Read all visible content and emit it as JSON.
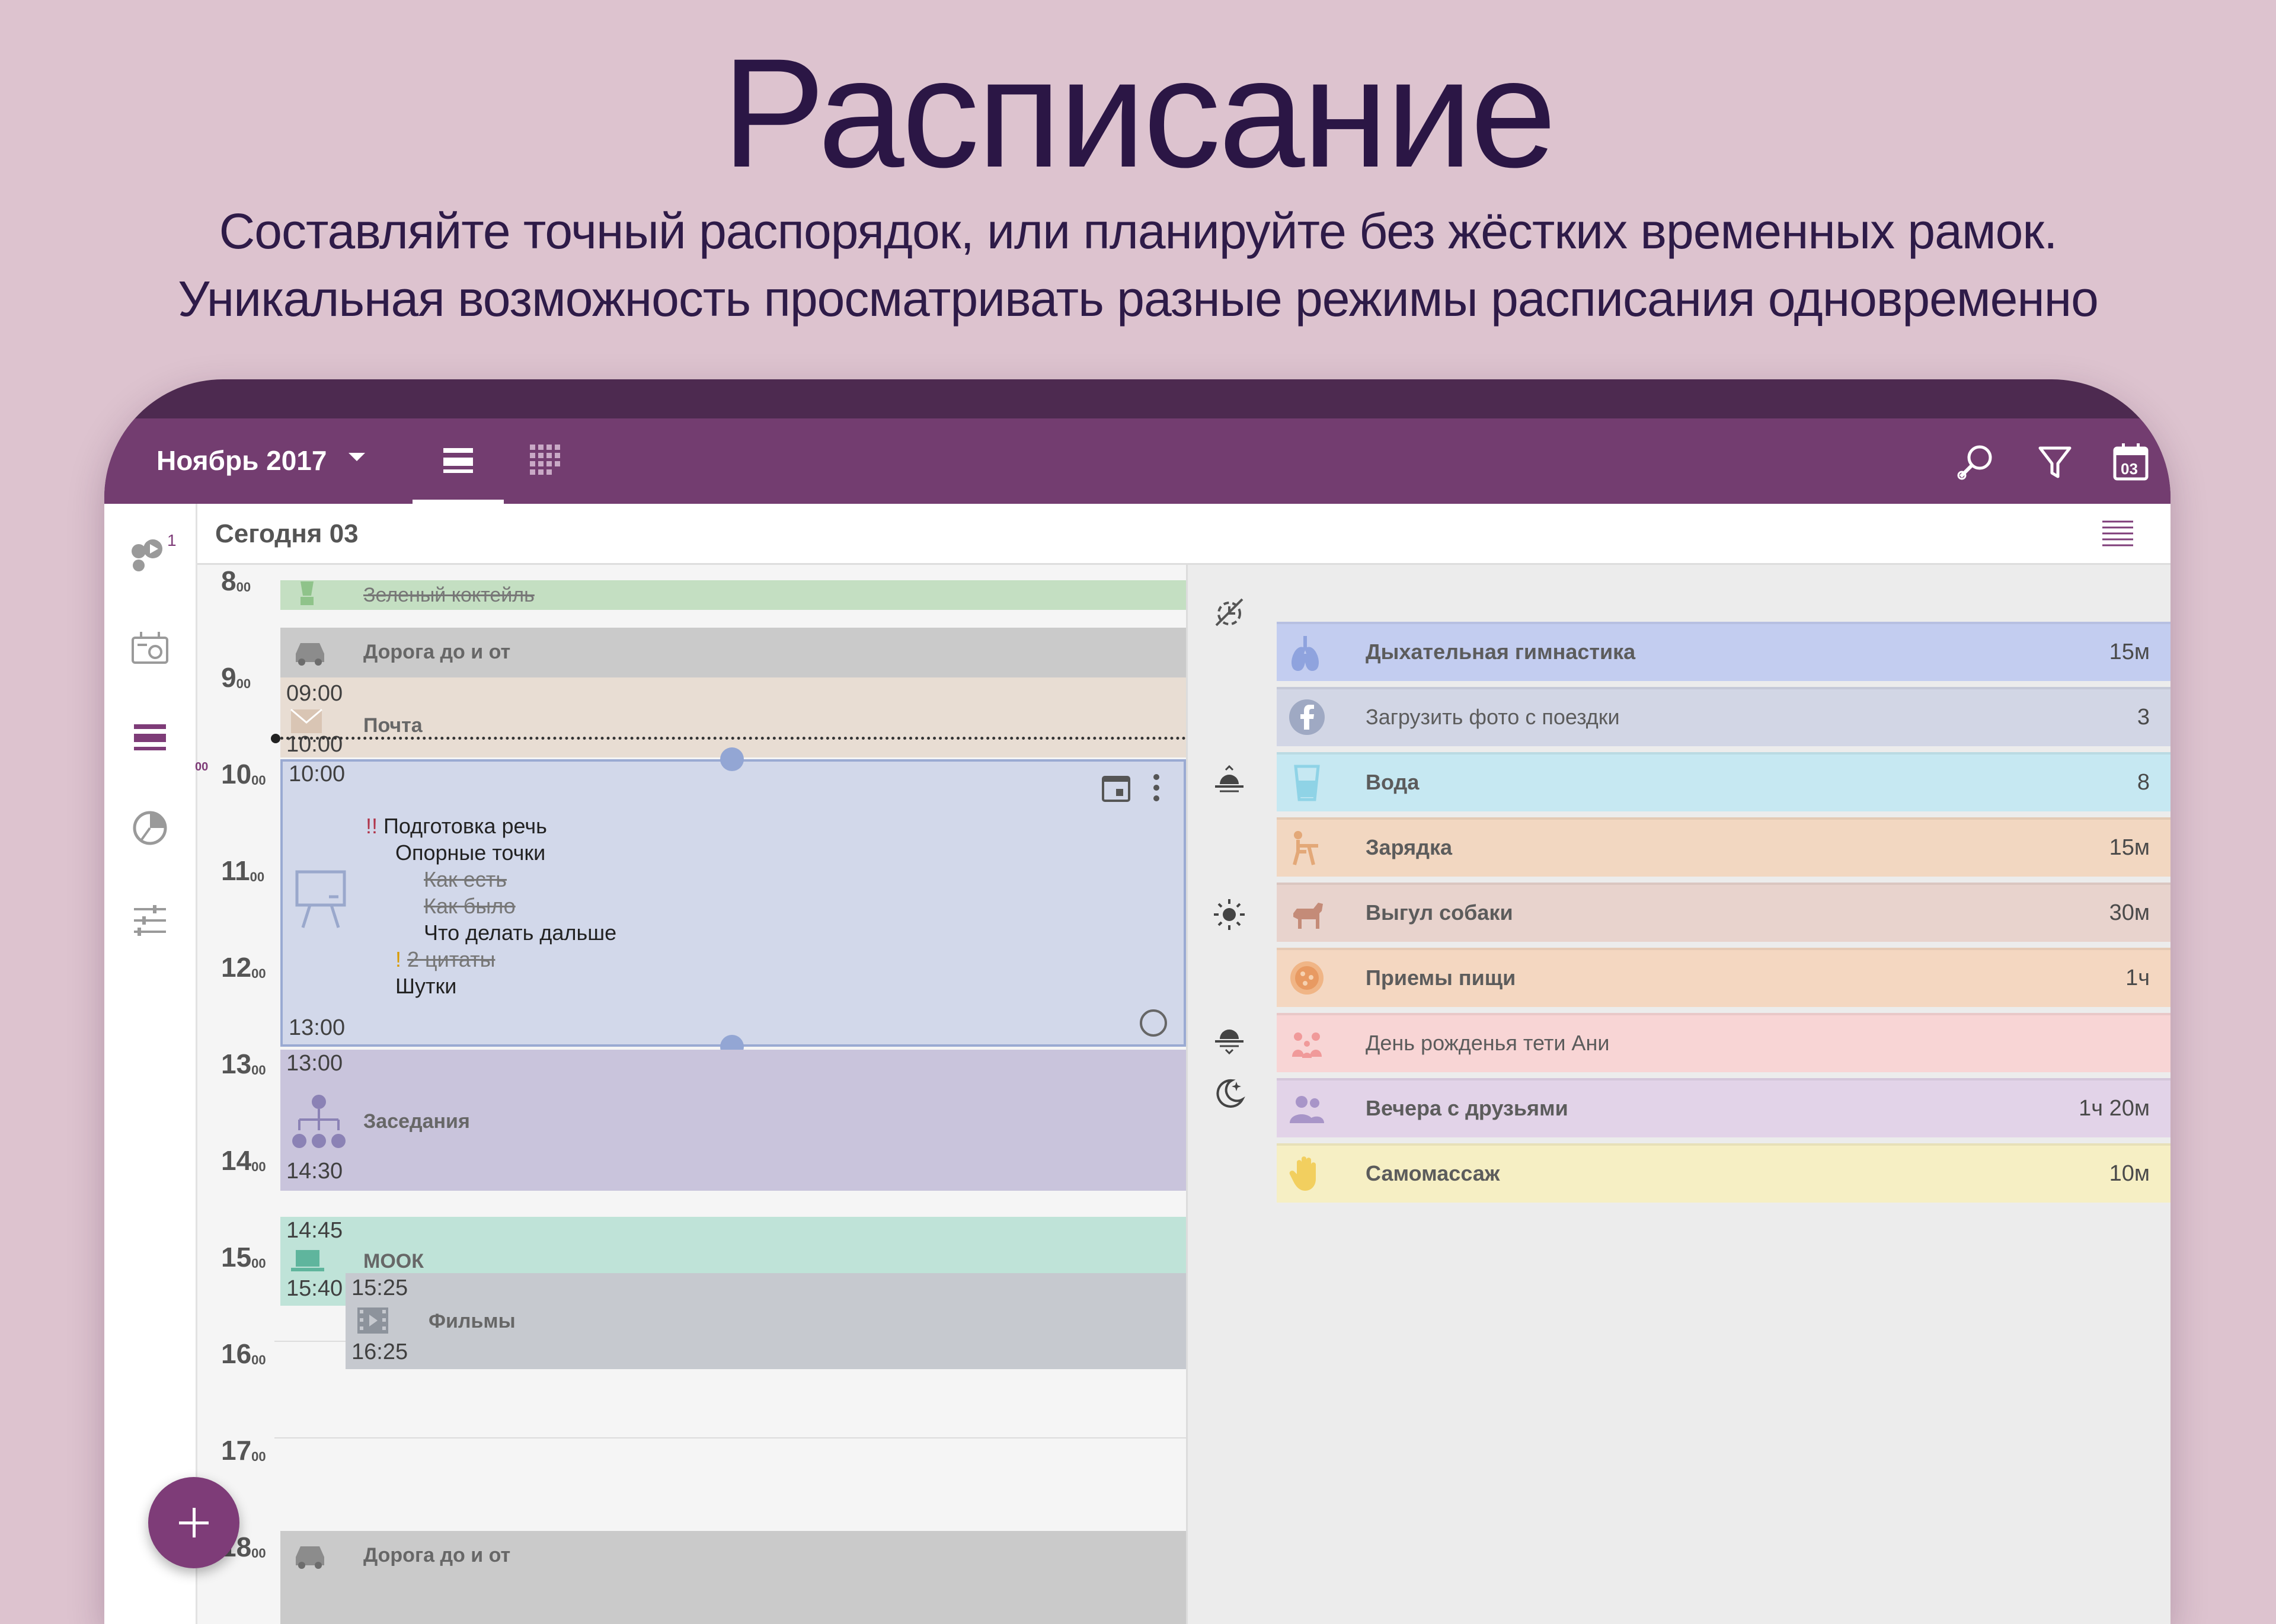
{
  "headline": {
    "title": "Расписание",
    "line1": "Составляйте точный распорядок, или планируйте без жёстких временных рамок.",
    "line2": "Уникальная возможность просматривать разные режимы расписания одновременно"
  },
  "appbar": {
    "month": "Ноябрь 2017",
    "calendar_day": "03",
    "color": "#733d70"
  },
  "sidebar": {
    "badge": "1"
  },
  "dayhead": {
    "label": "Сегодня  03"
  },
  "timeline": {
    "hours": [
      {
        "h": "8",
        "m": "00"
      },
      {
        "h": "9",
        "m": "00"
      },
      {
        "h": "10",
        "m": "00"
      },
      {
        "h": "11",
        "m": "00"
      },
      {
        "h": "12",
        "m": "00"
      },
      {
        "h": "13",
        "m": "00"
      },
      {
        "h": "14",
        "m": "00"
      },
      {
        "h": "15",
        "m": "00"
      },
      {
        "h": "16",
        "m": "00"
      },
      {
        "h": "17",
        "m": "00"
      },
      {
        "h": "18",
        "m": "00"
      }
    ],
    "now_marker_minutes": "00",
    "events": {
      "smoothie": {
        "title": "Зеленый коктейль"
      },
      "road1": {
        "title": "Дорога до и от"
      },
      "mail": {
        "title": "Почта",
        "start": "09:00",
        "end": "10:00"
      },
      "speech": {
        "start": "10:00",
        "end": "13:00",
        "notes": [
          {
            "mark": "!!",
            "text": "Подготовка речь"
          },
          {
            "text": "Опорные точки"
          },
          {
            "text": "Как есть"
          },
          {
            "text": "Как было"
          },
          {
            "text": "Что делать дальше"
          },
          {
            "mark": "!",
            "text": "2 цитаты"
          },
          {
            "text": "Шутки"
          }
        ]
      },
      "meetings": {
        "title": "Заседания",
        "start": "13:00",
        "end": "14:30"
      },
      "mook": {
        "title": "МООК",
        "start": "14:45",
        "end": "15:40"
      },
      "films": {
        "title": "Фильмы",
        "start": "15:25",
        "end": "16:25"
      },
      "road2": {
        "title": "Дорога до и от"
      }
    }
  },
  "tasks": [
    {
      "name": "Дыхательная гимнастика",
      "dur": "15м",
      "color": "#c3cdf0",
      "bold": true,
      "icon": "lungs-icon"
    },
    {
      "name": "Загрузить фото с поездки",
      "dur": "3",
      "color": "#d2d6e5",
      "bold": false,
      "icon": "facebook-icon"
    },
    {
      "name": "Вода",
      "dur": "8",
      "color": "#c6e8f2",
      "bold": true,
      "icon": "water-glass-icon"
    },
    {
      "name": "Зарядка",
      "dur": "15м",
      "color": "#f2d7c1",
      "bold": true,
      "icon": "exercise-icon"
    },
    {
      "name": "Выгул собаки",
      "dur": "30м",
      "color": "#e8d3cd",
      "bold": true,
      "icon": "dog-icon"
    },
    {
      "name": "Приемы пищи",
      "dur": "1ч",
      "color": "#f4d7c1",
      "bold": true,
      "icon": "pizza-icon"
    },
    {
      "name": "День рожденья тети Ани",
      "dur": "",
      "color": "#f8d5d5",
      "bold": false,
      "icon": "family-icon"
    },
    {
      "name": "Вечера с друзьями",
      "dur": "1ч 20м",
      "color": "#e2d3e8",
      "bold": true,
      "icon": "friends-icon"
    },
    {
      "name": "Самомассаж",
      "dur": "10м",
      "color": "#f6efc4",
      "bold": true,
      "icon": "hand-icon"
    }
  ]
}
